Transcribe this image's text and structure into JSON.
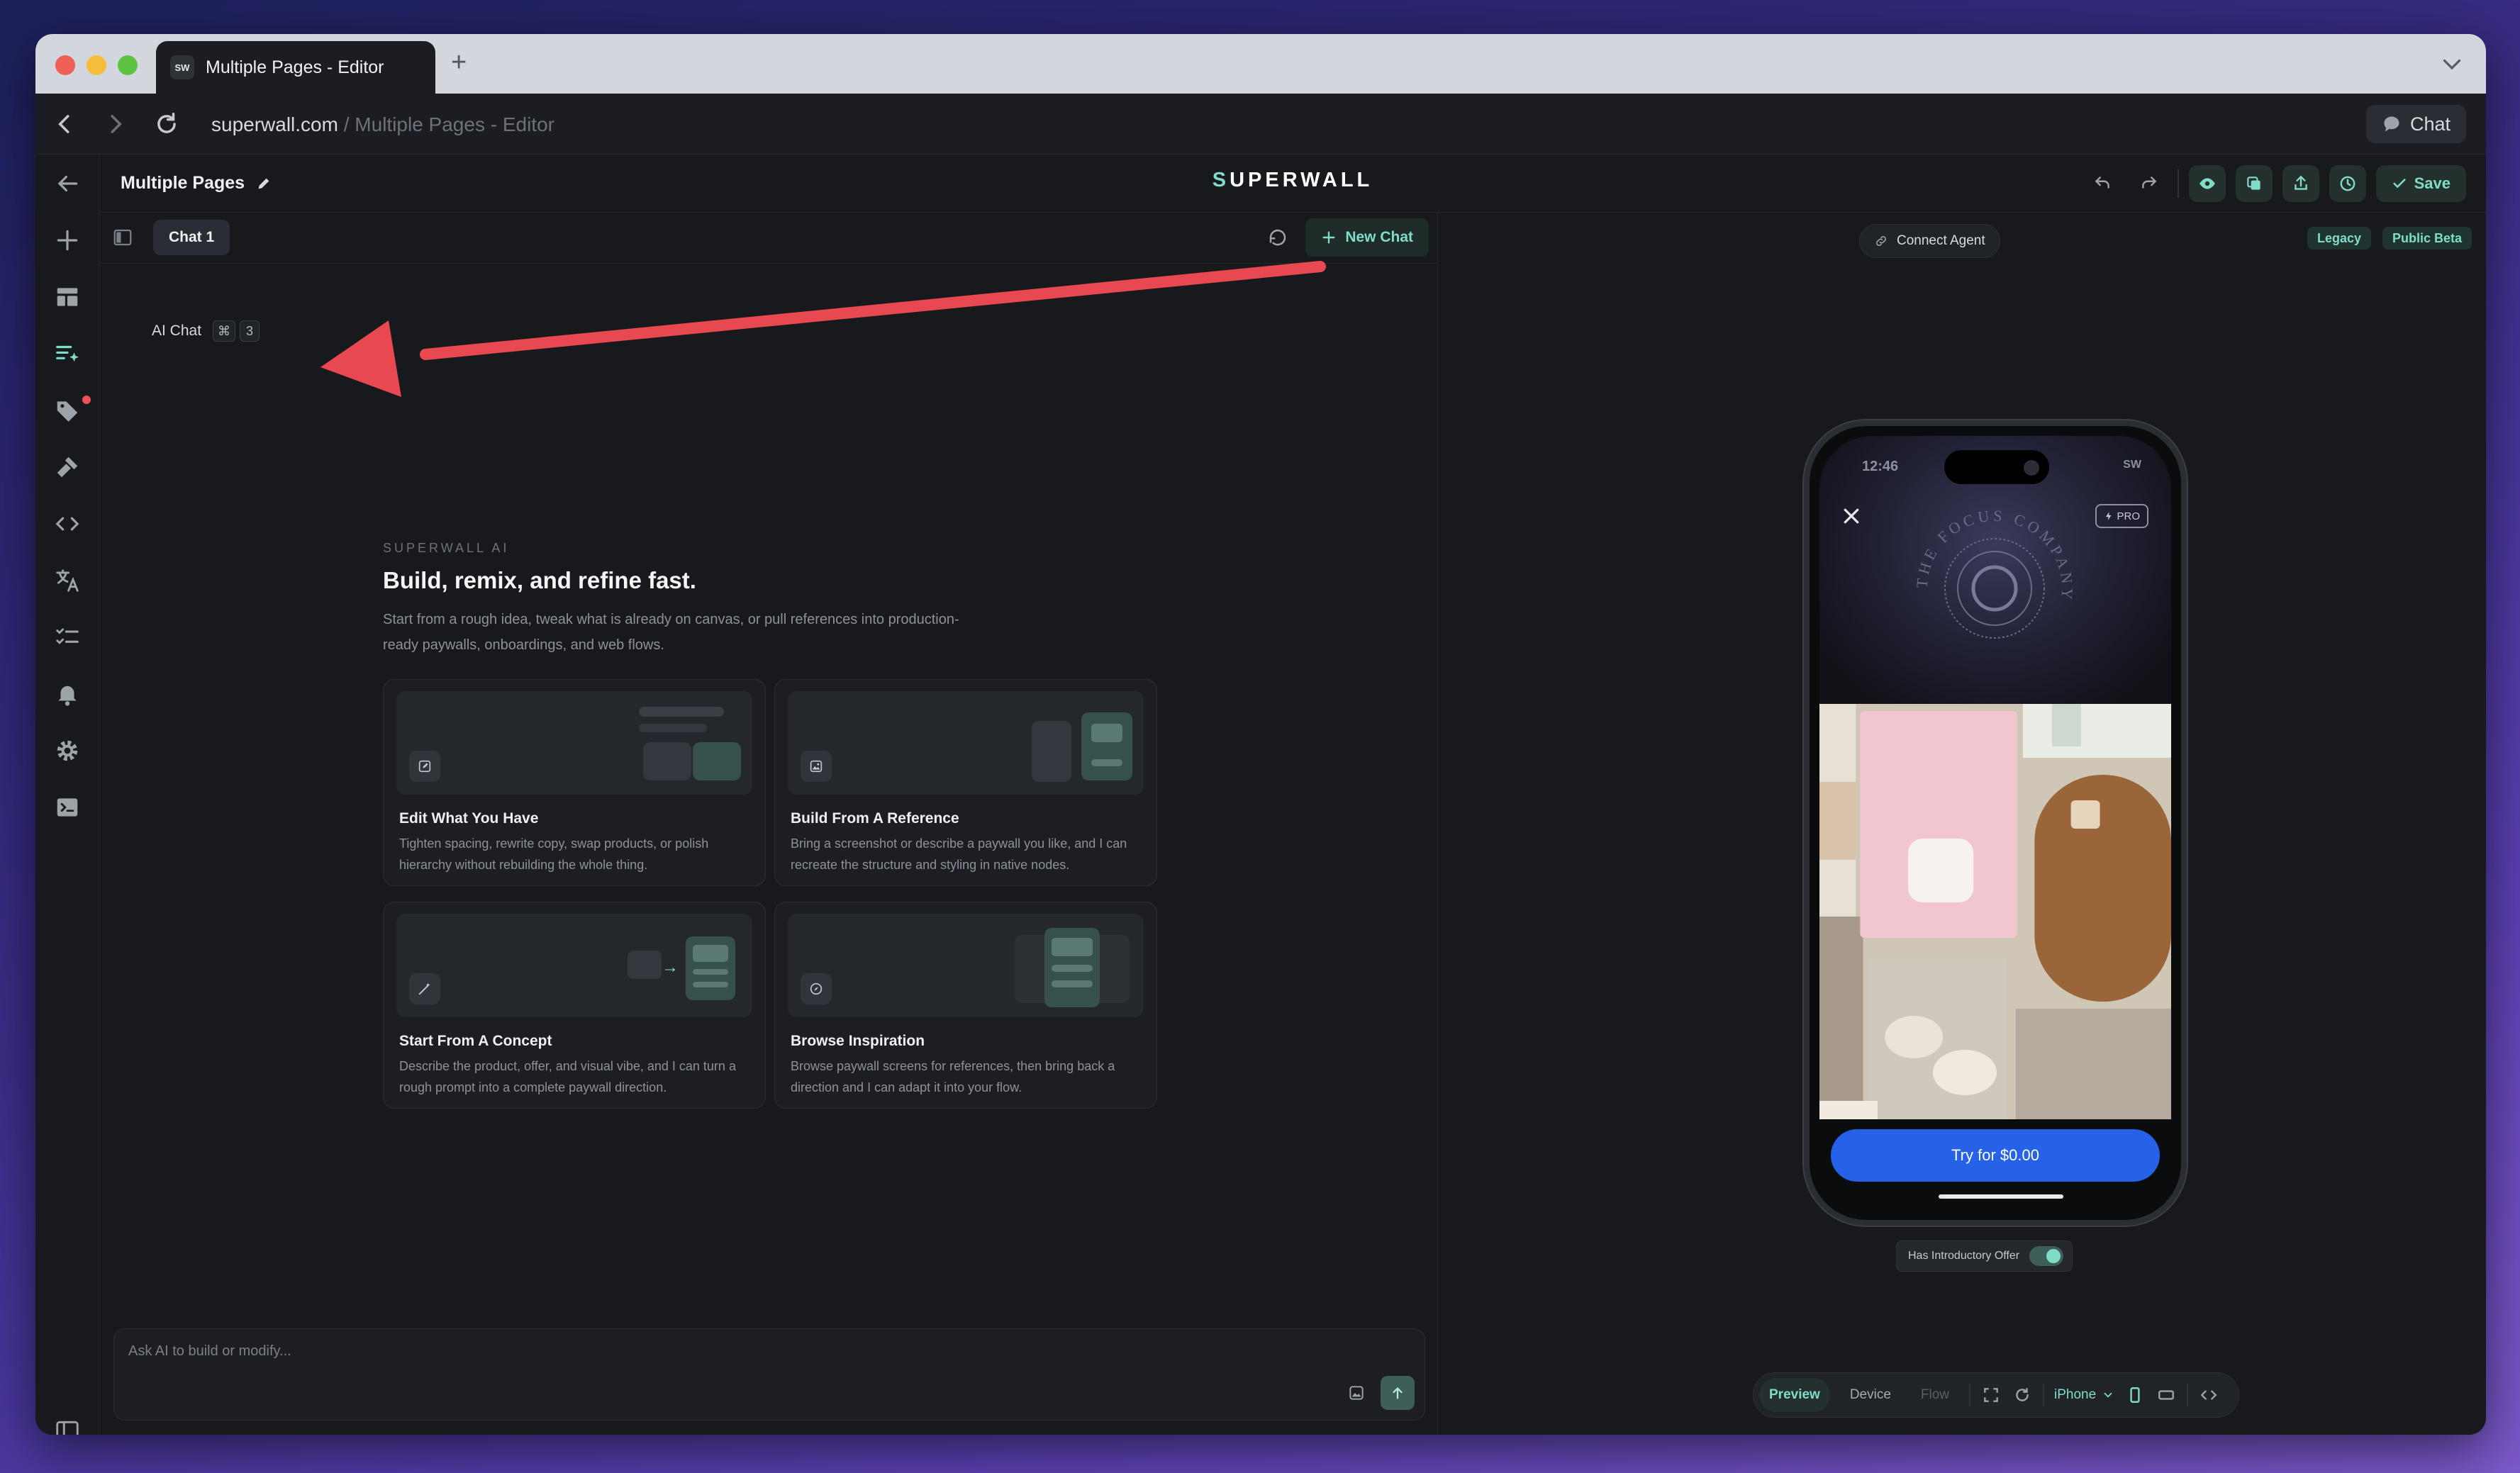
{
  "browser": {
    "tab_title": "Multiple Pages - Editor",
    "favicon_text": "SW",
    "url_domain": "superwall.com",
    "url_path": " / Multiple Pages - Editor",
    "chat_button": "Chat"
  },
  "editor": {
    "project_title": "Multiple Pages",
    "logo_prefix": "S",
    "logo_rest": "UPERWALL",
    "save_label": "Save"
  },
  "chat": {
    "tab_label": "Chat 1",
    "new_chat_label": "New Chat",
    "ai_chat_label": "AI Chat",
    "shortcut_key_1": "⌘",
    "shortcut_key_2": "3",
    "eyebrow": "SUPERWALL AI",
    "title": "Build, remix, and refine fast.",
    "subtitle": "Start from a rough idea, tweak what is already on canvas, or pull references into production-ready paywalls, onboardings, and web flows.",
    "cards": [
      {
        "title": "Edit What You Have",
        "desc": "Tighten spacing, rewrite copy, swap products, or polish hierarchy without rebuilding the whole thing.",
        "icon": "edit-icon"
      },
      {
        "title": "Build From A Reference",
        "desc": "Bring a screenshot or describe a paywall you like, and I can recreate the structure and styling in native nodes.",
        "icon": "image-icon"
      },
      {
        "title": "Start From A Concept",
        "desc": "Describe the product, offer, and visual vibe, and I can turn a rough prompt into a complete paywall direction.",
        "icon": "magic-wand-icon"
      },
      {
        "title": "Browse Inspiration",
        "desc": "Browse paywall screens for references, then bring back a direction and I can adapt it into your flow.",
        "icon": "compass-icon"
      }
    ],
    "composer_placeholder": "Ask AI to build or modify..."
  },
  "canvas": {
    "connect_agent": "Connect Agent",
    "badge_legacy": "Legacy",
    "badge_beta": "Public Beta",
    "phone": {
      "time": "12:46",
      "carrier": "SW",
      "pro_label": "PRO",
      "seal_text": "THE FOCUS COMPANY",
      "cta_label": "Try for $0.00"
    },
    "intro_offer_label": "Has Introductory Offer",
    "intro_offer_on": true,
    "bottom_bar": {
      "preview": "Preview",
      "device": "Device",
      "flow": "Flow",
      "device_name": "iPhone"
    }
  },
  "colors": {
    "accent": "#7fdcc8",
    "cta_blue": "#2562e8",
    "annotation_arrow": "#e8484f"
  }
}
